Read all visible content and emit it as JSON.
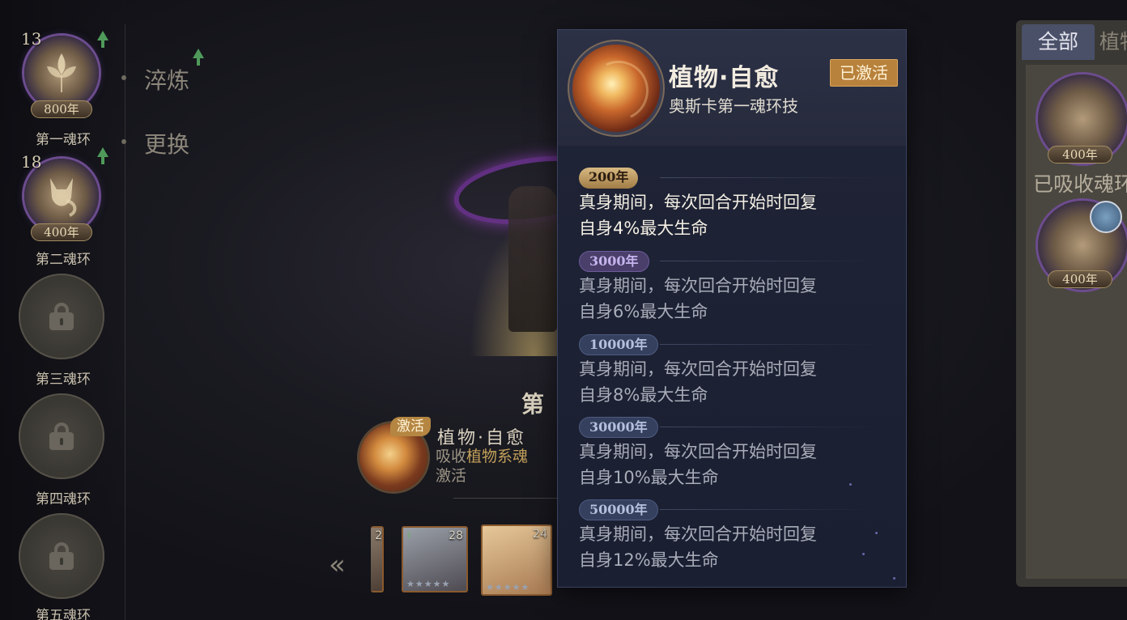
{
  "left_rings": [
    {
      "level": "13",
      "year": "800年",
      "name": "第一魂环",
      "upgradable": true
    },
    {
      "level": "18",
      "year": "400年",
      "name": "第二魂环",
      "upgradable": true
    },
    {
      "name": "第三魂环",
      "locked": true
    },
    {
      "name": "第四魂环",
      "locked": true
    },
    {
      "name": "第五魂环",
      "locked": true
    }
  ],
  "side_menu": {
    "refine": "淬炼",
    "replace": "更换"
  },
  "center": {
    "ring_title_partial": "第",
    "skill_tag": "激活",
    "skill_name": "植物·自愈",
    "skill_desc_prefix": "吸收",
    "skill_desc_highlight": "植物系魂",
    "skill_desc_line2": "激活"
  },
  "portraits": [
    {
      "level": "2"
    },
    {
      "level": "28"
    },
    {
      "level": "24"
    }
  ],
  "right_panel": {
    "tab_all": "全部",
    "tab_plant": "植物",
    "ring1_year": "400年",
    "absorbed_label": "已吸收魂环",
    "ring2_year": "400年"
  },
  "tooltip": {
    "title": "植物·自愈",
    "subtitle": "奥斯卡第一魂环技",
    "status_badge": "已激活",
    "tiers": [
      {
        "year": "200年",
        "line1": "真身期间，每次回合开始时回复",
        "line2": "自身4%最大生命",
        "active": true
      },
      {
        "year": "3000年",
        "line1": "真身期间，每次回合开始时回复",
        "line2": "自身6%最大生命",
        "active": false
      },
      {
        "year": "10000年",
        "line1": "真身期间，每次回合开始时回复",
        "line2": "自身8%最大生命",
        "active": false
      },
      {
        "year": "30000年",
        "line1": "真身期间，每次回合开始时回复",
        "line2": "自身10%最大生命",
        "active": false
      },
      {
        "year": "50000年",
        "line1": "真身期间，每次回合开始时回复",
        "line2": "自身12%最大生命",
        "active": false
      }
    ]
  },
  "colors": {
    "accent_gold": "#b8823c",
    "panel_bg": "#1f2436",
    "ring_purple": "#6c4c8e"
  }
}
